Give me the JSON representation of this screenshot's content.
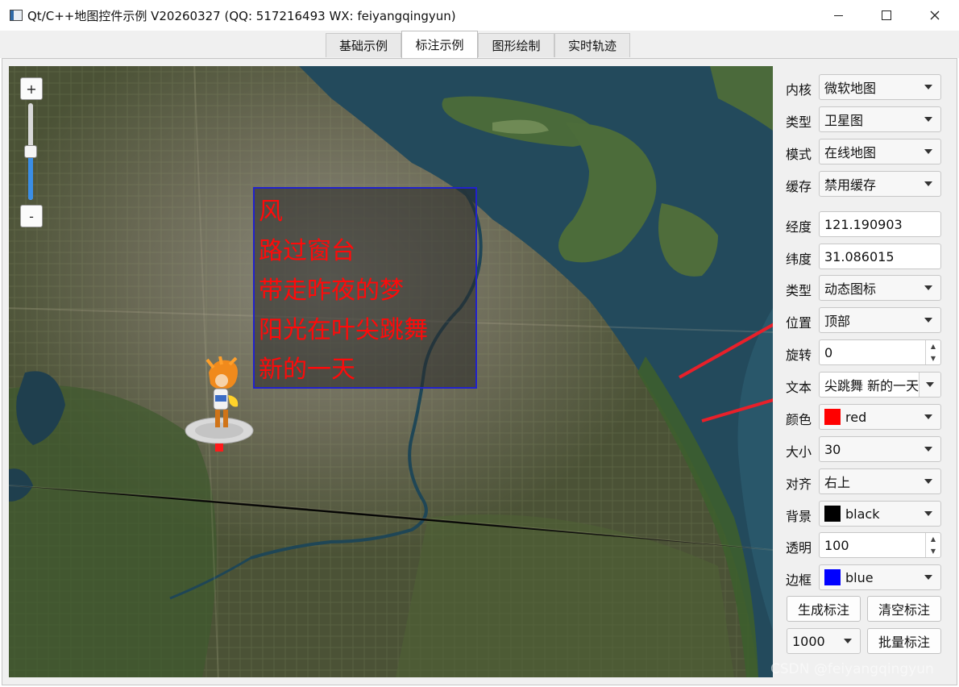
{
  "window": {
    "title": "Qt/C++地图控件示例 V20260327 (QQ: 517216493 WX: feiyangqingyun)",
    "controls": [
      "minimize-icon",
      "maximize-icon",
      "close-icon"
    ]
  },
  "tabs": [
    {
      "label": "基础示例",
      "active": false
    },
    {
      "label": "标注示例",
      "active": true
    },
    {
      "label": "图形绘制",
      "active": false
    },
    {
      "label": "实时轨迹",
      "active": false
    }
  ],
  "map": {
    "zoom_in_label": "+",
    "zoom_out_label": "-",
    "zoom_level_fraction": 0.45,
    "marker_text": [
      "风",
      "路过窗台",
      "带走昨夜的梦",
      "阳光在叶尖跳舞",
      "新的一天"
    ]
  },
  "panel": {
    "kernel": {
      "label": "内核",
      "value": "微软地图"
    },
    "map_type": {
      "label": "类型",
      "value": "卫星图"
    },
    "mode": {
      "label": "模式",
      "value": "在线地图"
    },
    "cache": {
      "label": "缓存",
      "value": "禁用缓存"
    },
    "longitude": {
      "label": "经度",
      "value": "121.190903"
    },
    "latitude": {
      "label": "纬度",
      "value": "31.086015"
    },
    "marker_type": {
      "label": "类型",
      "value": "动态图标"
    },
    "position": {
      "label": "位置",
      "value": "顶部"
    },
    "rotation": {
      "label": "旋转",
      "value": "0"
    },
    "text": {
      "label": "文本",
      "value": "尖跳舞 新的一天"
    },
    "color": {
      "label": "颜色",
      "value": "red",
      "swatch": "#ff0000"
    },
    "size": {
      "label": "大小",
      "value": "30"
    },
    "align": {
      "label": "对齐",
      "value": "右上"
    },
    "background": {
      "label": "背景",
      "value": "black",
      "swatch": "#000000"
    },
    "opacity": {
      "label": "透明",
      "value": "100"
    },
    "border": {
      "label": "边框",
      "value": "blue",
      "swatch": "#0000ff"
    },
    "generate_button": "生成标注",
    "clear_button": "清空标注",
    "batch_count": "1000",
    "batch_button": "批量标注"
  },
  "watermark": "CSDN @feiyangqingyun",
  "colors": {
    "marker_text": "#ff0a0a",
    "marker_border": "#2222cc",
    "arrow": "#e8202a",
    "zoom_accent": "#3a8ee6"
  }
}
